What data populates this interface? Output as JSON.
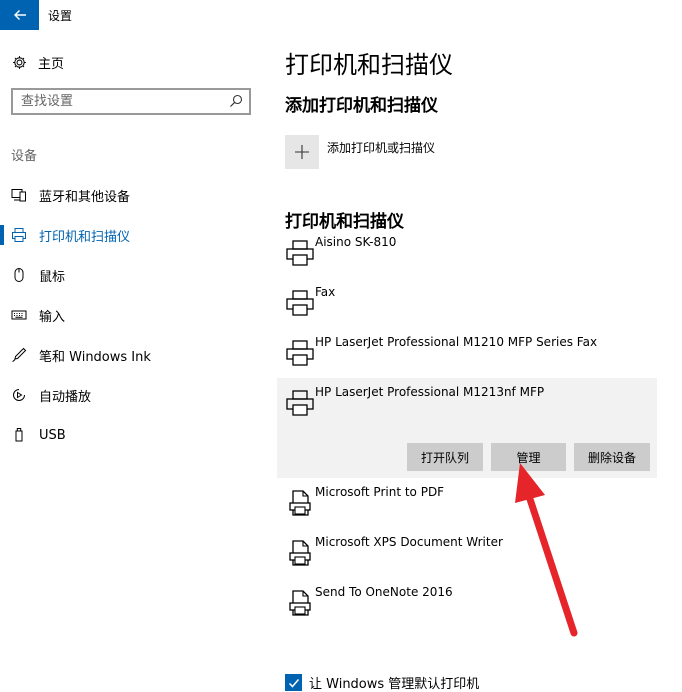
{
  "window": {
    "title": "设置"
  },
  "sidebar": {
    "home_label": "主页",
    "search_placeholder": "查找设置",
    "section_label": "设备",
    "items": [
      {
        "label": "蓝牙和其他设备",
        "icon": "bluetooth-devices-icon"
      },
      {
        "label": "打印机和扫描仪",
        "icon": "printer-icon",
        "active": true
      },
      {
        "label": "鼠标",
        "icon": "mouse-icon"
      },
      {
        "label": "输入",
        "icon": "keyboard-icon"
      },
      {
        "label": "笔和 Windows Ink",
        "icon": "pen-icon"
      },
      {
        "label": "自动播放",
        "icon": "autoplay-icon"
      },
      {
        "label": "USB",
        "icon": "usb-icon"
      }
    ]
  },
  "main": {
    "title": "打印机和扫描仪",
    "add_section": "添加打印机和扫描仪",
    "add_label": "添加打印机或扫描仪",
    "list_section": "打印机和扫描仪",
    "printers": [
      {
        "name": "Aisino SK-810",
        "icon": "printer-icon"
      },
      {
        "name": "Fax",
        "icon": "printer-icon"
      },
      {
        "name": "HP LaserJet Professional M1210 MFP Series Fax",
        "icon": "printer-icon"
      },
      {
        "name": "HP LaserJet Professional M1213nf MFP",
        "icon": "printer-icon",
        "selected": true
      },
      {
        "name": "Microsoft Print to PDF",
        "icon": "virtual-printer-icon"
      },
      {
        "name": "Microsoft XPS Document Writer",
        "icon": "virtual-printer-icon"
      },
      {
        "name": "Send To OneNote 2016",
        "icon": "virtual-printer-icon"
      }
    ],
    "actions": {
      "queue": "打开队列",
      "manage": "管理",
      "remove": "删除设备"
    },
    "default_printer": {
      "label": "让 Windows 管理默认打印机",
      "checked": true
    }
  },
  "colors": {
    "accent": "#0063b1",
    "button": "#cccccc",
    "selected_bg": "#f2f2f2",
    "annotation": "#e5252a"
  }
}
